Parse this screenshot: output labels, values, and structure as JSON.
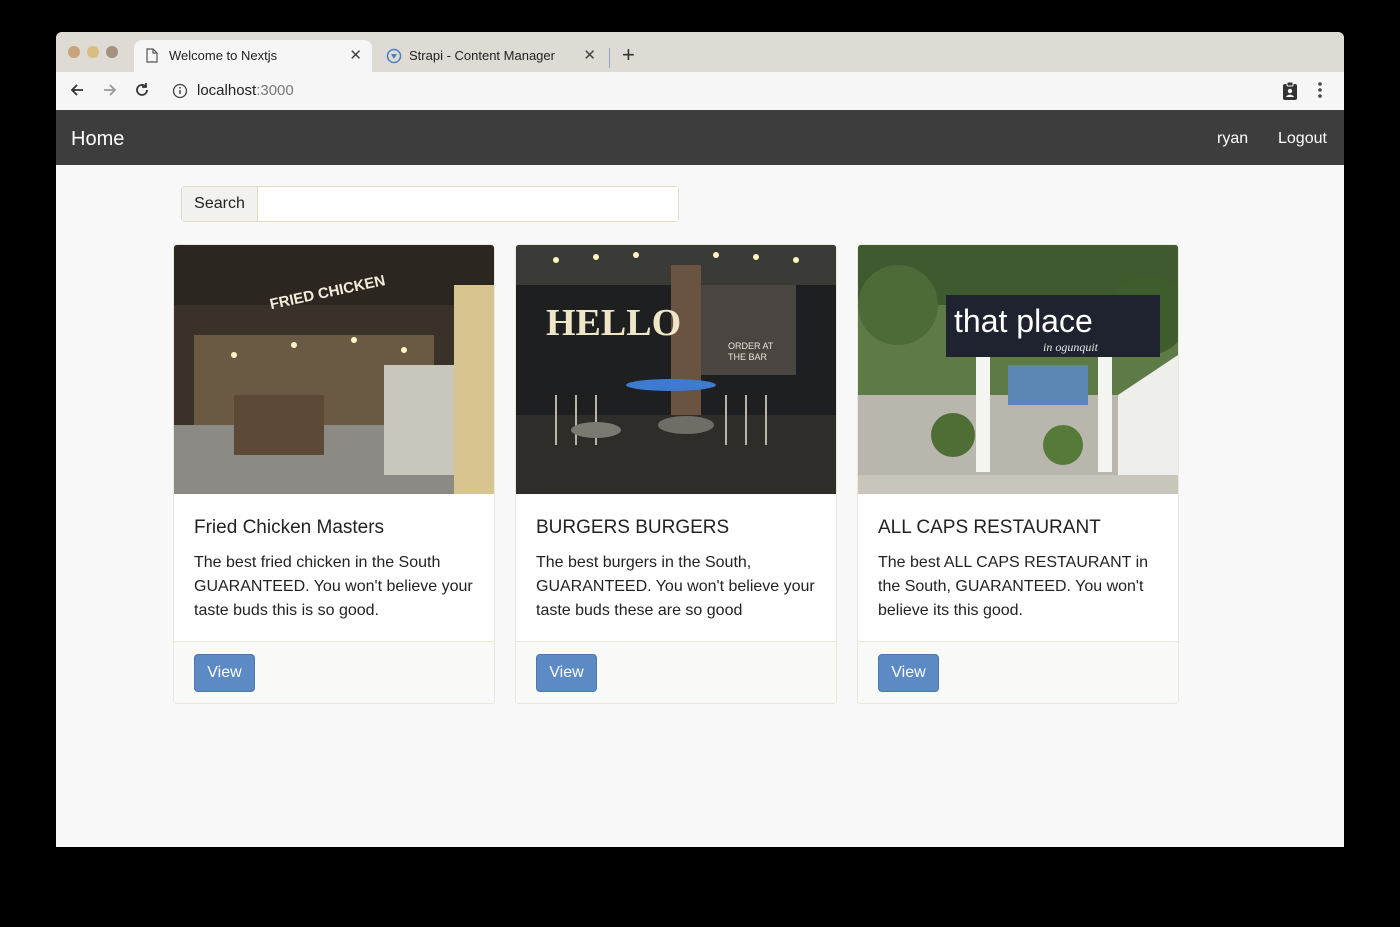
{
  "browser": {
    "tabs": [
      {
        "title": "Welcome to Nextjs",
        "active": true,
        "icon": "document-icon"
      },
      {
        "title": "Strapi - Content Manager",
        "active": false,
        "icon": "strapi-icon"
      }
    ],
    "new_tab_icon": "plus-icon",
    "url": {
      "host": "localhost",
      "port": ":3000"
    }
  },
  "navbar": {
    "home_label": "Home",
    "user_label": "ryan",
    "logout_label": "Logout",
    "background": "#3d3d3d"
  },
  "search": {
    "label": "Search",
    "value": ""
  },
  "restaurants": [
    {
      "name": "Fried Chicken Masters",
      "description": "The best fried chicken in the South GUARANTEED. You won't believe your taste buds this is so good.",
      "button_label": "View",
      "image_sign": "FRIED CHICKEN"
    },
    {
      "name": "BURGERS BURGERS",
      "description": "The best burgers in the South, GUARANTEED. You won't believe your taste buds these are so good",
      "button_label": "View",
      "image_sign": "HELLO",
      "image_board": [
        "ORDER AT",
        "THE BAR"
      ]
    },
    {
      "name": "ALL CAPS RESTAURANT",
      "description": "The best ALL CAPS RESTAURANT in the South, GUARANTEED. You won't believe its this good.",
      "button_label": "View",
      "image_sign": "that place",
      "image_sign_sub": "in ogunquit"
    }
  ],
  "colors": {
    "primary_button": "#5b8ac4",
    "page_background": "#f8f8f8"
  }
}
